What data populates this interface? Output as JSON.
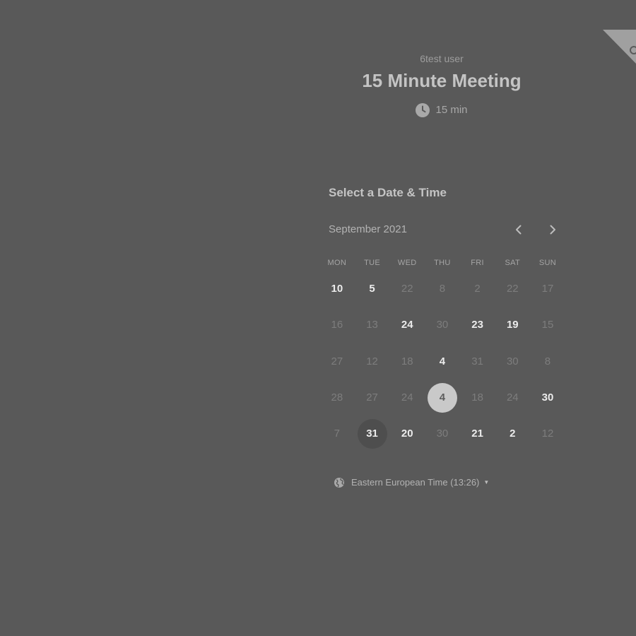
{
  "header": {
    "organizer": "6test user",
    "event_title": "15 Minute Meeting",
    "duration": "15 min"
  },
  "scheduler": {
    "title": "Select a Date & Time",
    "month": "September 2021"
  },
  "calendar": {
    "weekdays": [
      "MON",
      "TUE",
      "WED",
      "THU",
      "FRI",
      "SAT",
      "SUN"
    ],
    "rows": [
      [
        {
          "label": "10",
          "state": "available"
        },
        {
          "label": "5",
          "state": "available"
        },
        {
          "label": "22",
          "state": "disabled"
        },
        {
          "label": "8",
          "state": "disabled"
        },
        {
          "label": "2",
          "state": "disabled"
        },
        {
          "label": "22",
          "state": "disabled"
        },
        {
          "label": "17",
          "state": "disabled"
        }
      ],
      [
        {
          "label": "16",
          "state": "disabled"
        },
        {
          "label": "13",
          "state": "disabled"
        },
        {
          "label": "24",
          "state": "available"
        },
        {
          "label": "30",
          "state": "disabled"
        },
        {
          "label": "23",
          "state": "available"
        },
        {
          "label": "19",
          "state": "available"
        },
        {
          "label": "15",
          "state": "disabled"
        }
      ],
      [
        {
          "label": "27",
          "state": "disabled"
        },
        {
          "label": "12",
          "state": "disabled"
        },
        {
          "label": "18",
          "state": "disabled"
        },
        {
          "label": "4",
          "state": "available"
        },
        {
          "label": "31",
          "state": "disabled"
        },
        {
          "label": "30",
          "state": "disabled"
        },
        {
          "label": "8",
          "state": "disabled"
        }
      ],
      [
        {
          "label": "28",
          "state": "disabled"
        },
        {
          "label": "27",
          "state": "disabled"
        },
        {
          "label": "24",
          "state": "disabled"
        },
        {
          "label": "4",
          "state": "selected"
        },
        {
          "label": "18",
          "state": "disabled"
        },
        {
          "label": "24",
          "state": "disabled"
        },
        {
          "label": "30",
          "state": "available"
        }
      ],
      [
        {
          "label": "7",
          "state": "disabled"
        },
        {
          "label": "31",
          "state": "today"
        },
        {
          "label": "20",
          "state": "available"
        },
        {
          "label": "30",
          "state": "disabled"
        },
        {
          "label": "21",
          "state": "available"
        },
        {
          "label": "2",
          "state": "available"
        },
        {
          "label": "12",
          "state": "disabled"
        }
      ]
    ]
  },
  "timezone": {
    "label": "Eastern European Time (13:26)"
  },
  "icons": {
    "duration": "clock-icon",
    "timezone": "globe-icon",
    "prev": "chevron-left-icon",
    "next": "chevron-right-icon",
    "timezone_caret": "caret-down-icon",
    "corner": "corner-ribbon"
  },
  "colors": {
    "background": "#595959",
    "selected_day_bg": "#c9c9c9",
    "today_bg": "#4e4e4e",
    "available_text": "#ececec",
    "disabled_text": "#7d7d7d"
  }
}
